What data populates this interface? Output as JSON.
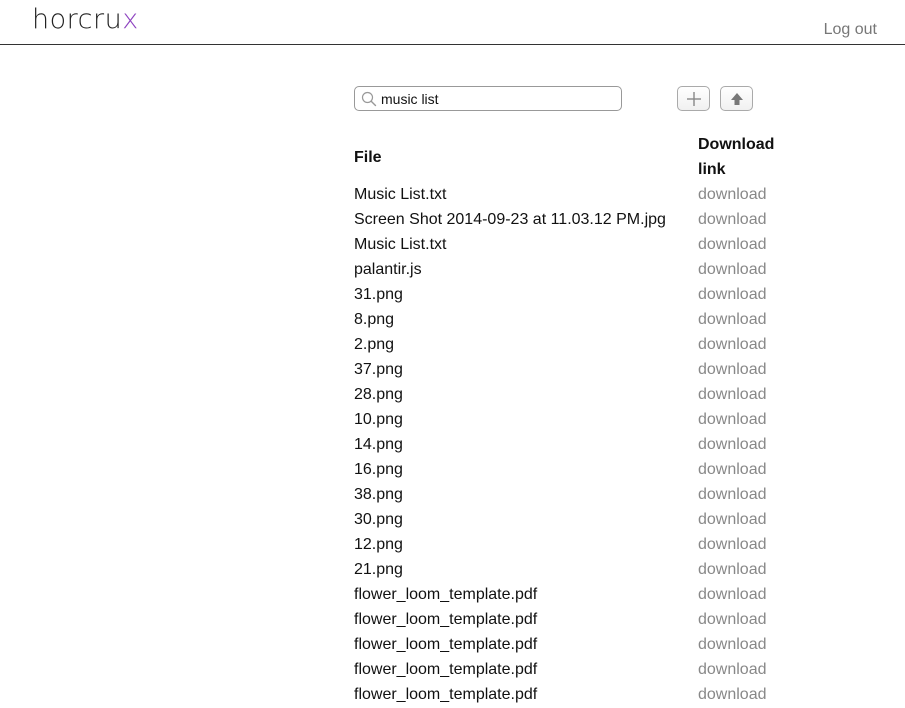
{
  "header": {
    "logo_main": "horcru",
    "logo_accent": "x",
    "logout_label": "Log out"
  },
  "search": {
    "value": "music list",
    "placeholder": ""
  },
  "toolbar": {
    "add_icon": "plus-icon",
    "upload_icon": "upload-arrow-icon"
  },
  "table": {
    "headers": {
      "file": "File",
      "download_line1": "Download",
      "download_line2": "link"
    },
    "rows": [
      {
        "file": "Music List.txt",
        "link": "download"
      },
      {
        "file": "Screen Shot 2014-09-23 at 11.03.12 PM.jpg",
        "link": "download"
      },
      {
        "file": "Music List.txt",
        "link": "download"
      },
      {
        "file": "palantir.js",
        "link": "download"
      },
      {
        "file": "31.png",
        "link": "download"
      },
      {
        "file": "8.png",
        "link": "download"
      },
      {
        "file": "2.png",
        "link": "download"
      },
      {
        "file": "37.png",
        "link": "download"
      },
      {
        "file": "28.png",
        "link": "download"
      },
      {
        "file": "10.png",
        "link": "download"
      },
      {
        "file": "14.png",
        "link": "download"
      },
      {
        "file": "16.png",
        "link": "download"
      },
      {
        "file": "38.png",
        "link": "download"
      },
      {
        "file": "30.png",
        "link": "download"
      },
      {
        "file": "12.png",
        "link": "download"
      },
      {
        "file": "21.png",
        "link": "download"
      },
      {
        "file": "flower_loom_template.pdf",
        "link": "download"
      },
      {
        "file": "flower_loom_template.pdf",
        "link": "download"
      },
      {
        "file": "flower_loom_template.pdf",
        "link": "download"
      },
      {
        "file": "flower_loom_template.pdf",
        "link": "download"
      },
      {
        "file": "flower_loom_template.pdf",
        "link": "download"
      }
    ]
  },
  "colors": {
    "logo_accent": "#8e44c0",
    "link": "#888888",
    "header_rule": "#333333"
  }
}
